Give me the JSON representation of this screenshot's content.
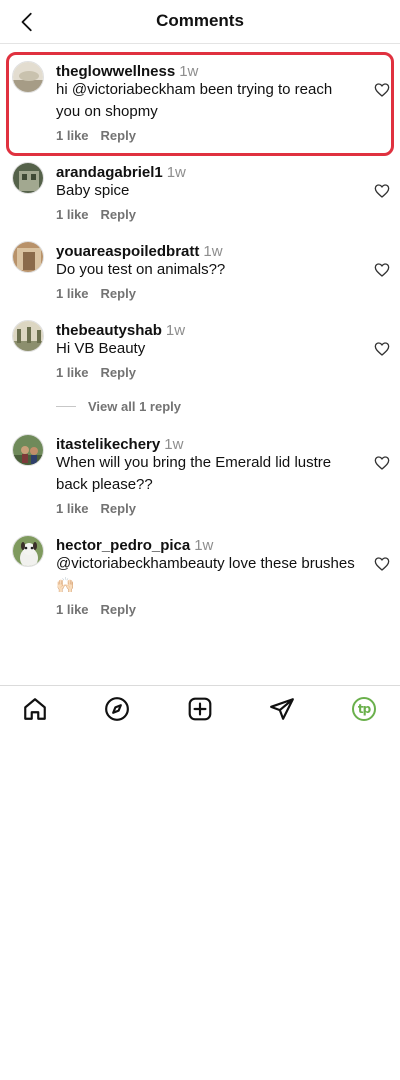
{
  "header": {
    "title": "Comments"
  },
  "comments": [
    {
      "username": "theglowwellness",
      "time": "1w",
      "text": "hi @victoriabeckham been trying to reach you on shopmy",
      "likes": "1 like",
      "reply": "Reply"
    },
    {
      "username": "arandagabriel1",
      "time": "1w",
      "text": "Baby spice",
      "likes": "1 like",
      "reply": "Reply"
    },
    {
      "username": "youareaspoiledbratt",
      "time": "1w",
      "text": "Do you test on animals??",
      "likes": "1 like",
      "reply": "Reply"
    },
    {
      "username": "thebeautyshab",
      "time": "1w",
      "text": "Hi VB Beauty",
      "likes": "1 like",
      "reply": "Reply",
      "view_replies": "View all 1 reply"
    },
    {
      "username": "itastelikechery",
      "time": "1w",
      "text": "When will you bring the Emerald lid lustre back please??",
      "likes": "1 like",
      "reply": "Reply"
    },
    {
      "username": "hector_pedro_pica",
      "time": "1w",
      "text": "@victoriabeckhambeauty love these brushes 🙌🏻",
      "likes": "1 like",
      "reply": "Reply"
    }
  ],
  "nav": {
    "items": [
      "home-icon",
      "explore-icon",
      "create-icon",
      "direct-icon",
      "profile-icon"
    ],
    "profile_initials": "tp",
    "profile_color": "#6ab04c"
  },
  "colors": {
    "highlight": "#e0313f",
    "muted": "#737373"
  }
}
